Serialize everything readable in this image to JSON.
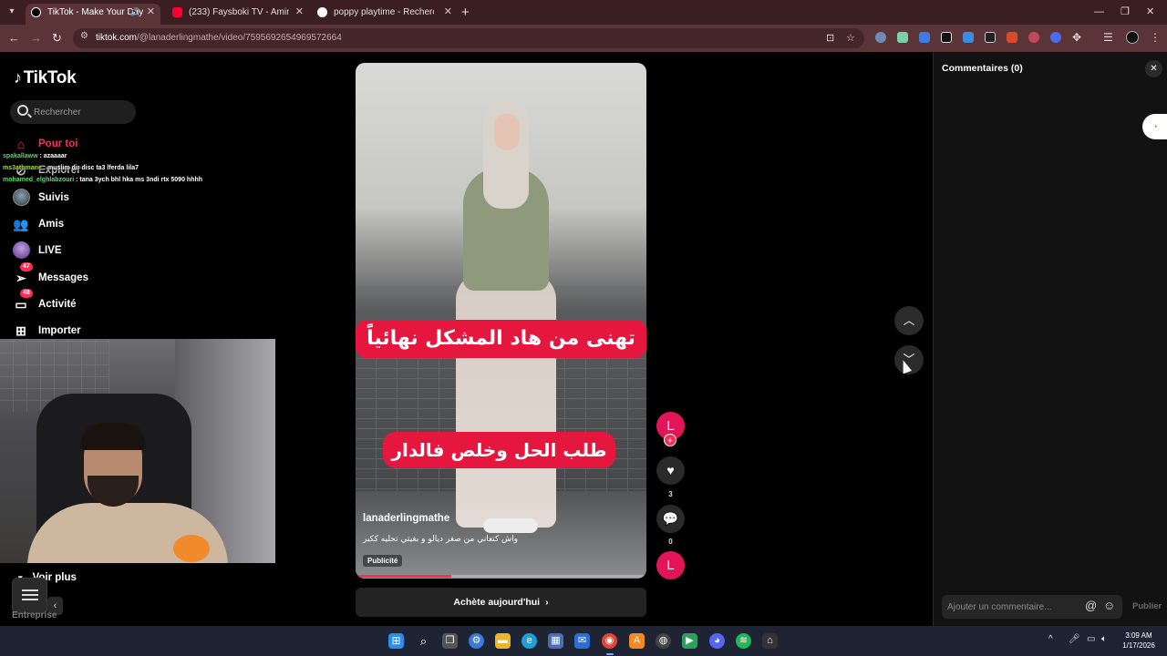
{
  "browser": {
    "tabs": [
      {
        "title": "TikTok - Make Your Day",
        "active": true
      },
      {
        "title": "(233) Faysboki TV - Amine iMrni",
        "active": false
      },
      {
        "title": "poppy playtime - Recherche Go",
        "active": false
      }
    ],
    "url_host": "tiktok.com",
    "url_path": "/@lanaderlingmathe/video/7595692654969572664"
  },
  "sidebar": {
    "logo": "TikTok",
    "search_placeholder": "Rechercher",
    "items": [
      {
        "label": "Pour toi",
        "icon": "home-icon",
        "active": true
      },
      {
        "label": "Explorer",
        "icon": "compass-icon"
      },
      {
        "label": "Suivis",
        "icon": "following-avatar-icon"
      },
      {
        "label": "Amis",
        "icon": "friends-icon"
      },
      {
        "label": "LIVE",
        "icon": "live-avatar-icon"
      },
      {
        "label": "Messages",
        "icon": "messages-icon",
        "badge": "47"
      },
      {
        "label": "Activité",
        "icon": "activity-icon",
        "badge": "48"
      },
      {
        "label": "Importer",
        "icon": "upload-icon"
      }
    ],
    "see_more": "Voir plus",
    "footer": "Entreprise"
  },
  "stream_chat": [
    {
      "user": "spakallaww",
      "message": "azaaaar"
    },
    {
      "user": "ms3athmane",
      "message": "muslim dir disc ta3 lferda lila7"
    },
    {
      "user": "mohamed_elghlabzouri",
      "message": "tana 3ych bhl hka ms 3ndi rtx 5090 hhhh"
    }
  ],
  "video": {
    "caption_top": "تهنى من هاد المشكل نهائياً",
    "caption_bottom": "طلب الحل وخلص فالدار",
    "author": "lanaderlingmathe",
    "description": "واش كتعاني من صغر ديالو و بغيتي تحليه ككبر",
    "sponsored": "Publicité",
    "progress_percent": 33,
    "cta": "Achète aujourd'hui"
  },
  "actions": {
    "avatar_letter": "L",
    "likes": "3",
    "comments": "0",
    "music_letter": "L"
  },
  "comments_panel": {
    "title": "Commentaires",
    "count": "(0)",
    "input_placeholder": "Ajouter un commentaire...",
    "publish": "Publier"
  },
  "taskbar": {
    "time": "3:09 AM",
    "date": "1/17/2026"
  },
  "colors": {
    "accent": "#fe2c55",
    "tab_bar": "#3a1e22",
    "address_bar": "#5b3438"
  }
}
